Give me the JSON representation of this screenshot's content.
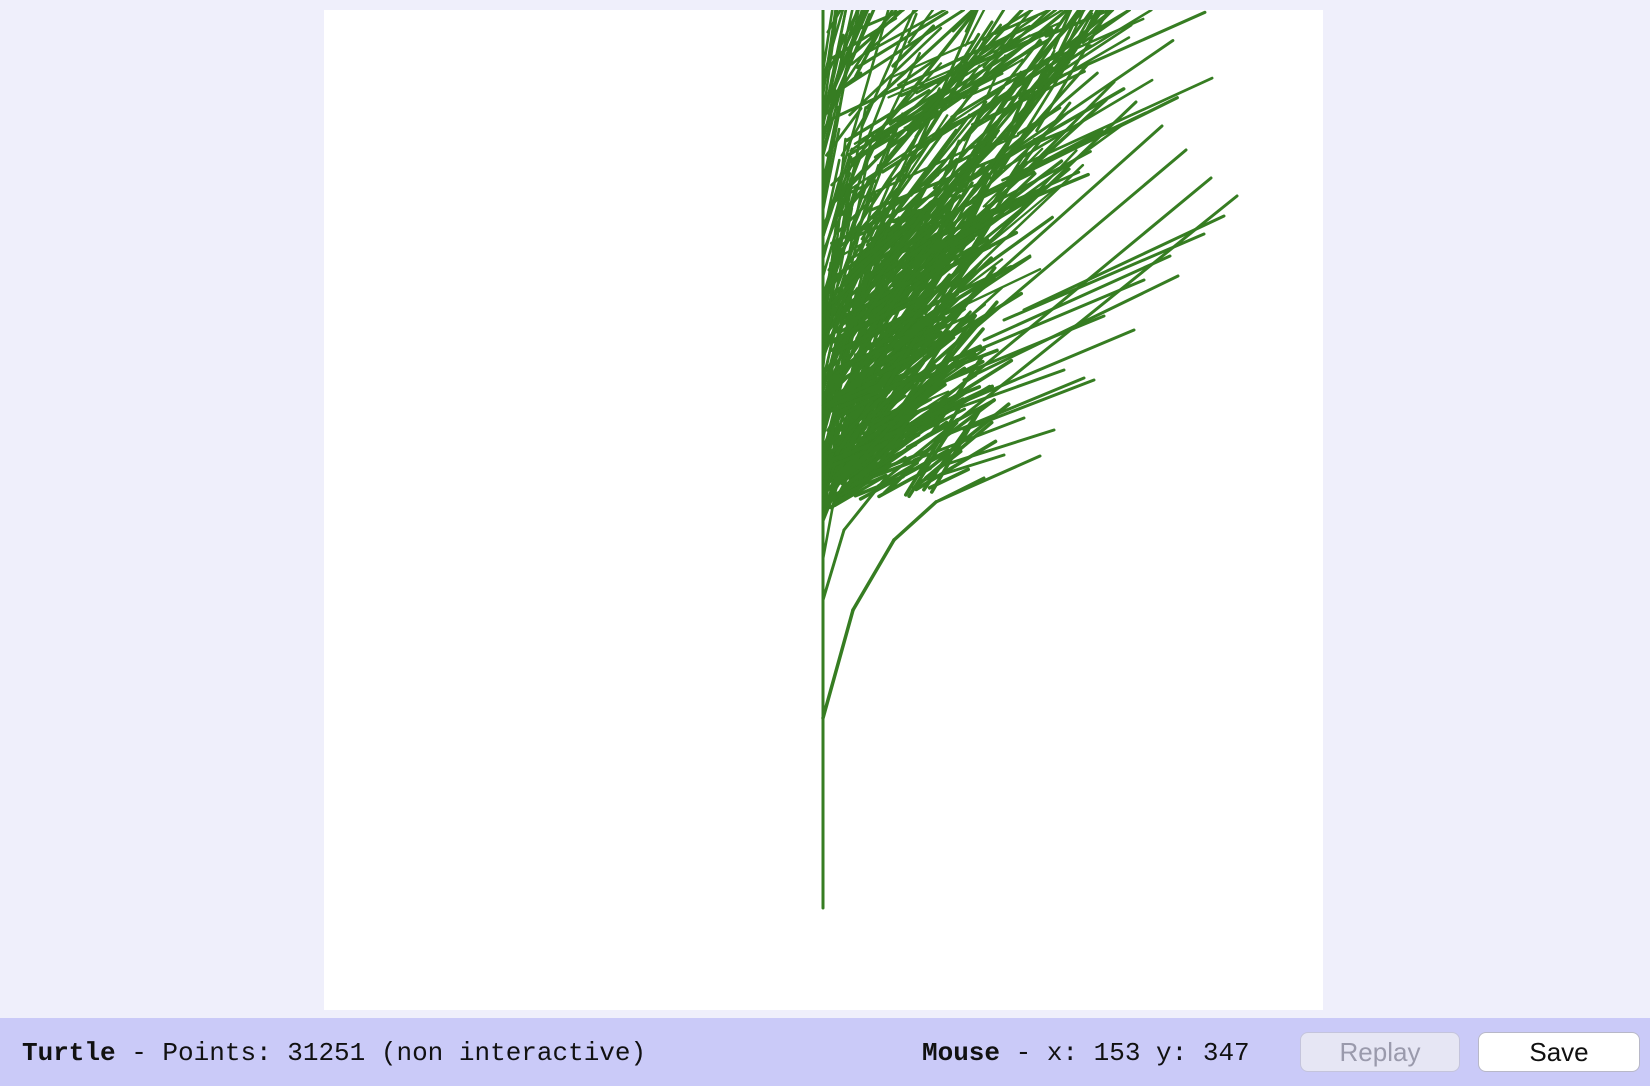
{
  "app": {
    "background_color": "#efeffb",
    "canvas_color": "#ffffff"
  },
  "drawing": {
    "stroke_color": "#367d22"
  },
  "status": {
    "turtle_label": "Turtle",
    "turtle_info": " - Points: 31251 (non interactive)",
    "mouse_label": "Mouse",
    "mouse_info": " - x: 153 y: 347"
  },
  "buttons": {
    "replay_label": "Replay",
    "replay_enabled": false,
    "save_label": "Save"
  }
}
